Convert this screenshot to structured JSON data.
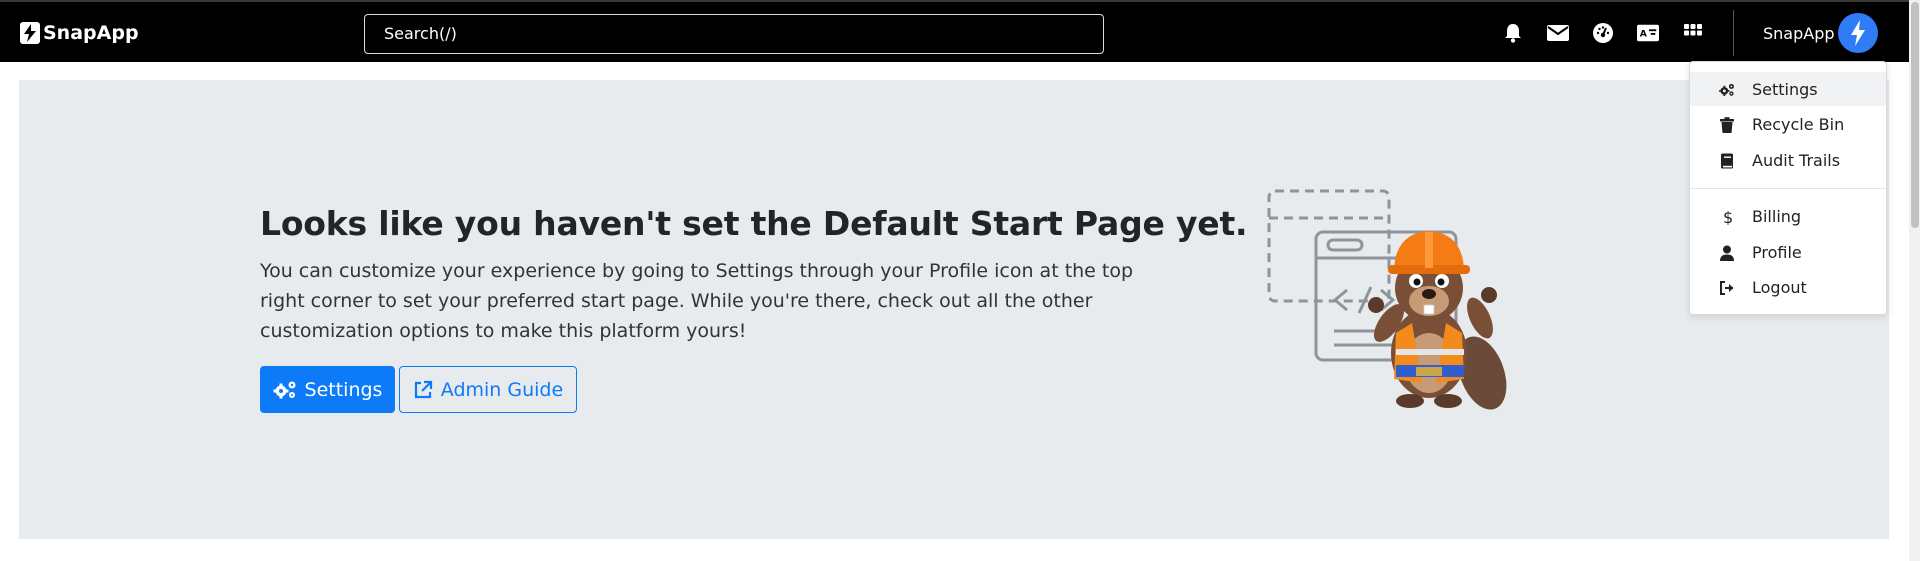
{
  "brand": {
    "name": "SnapApp"
  },
  "search": {
    "placeholder": "Search(/)"
  },
  "nav": {
    "icons": [
      "bell-icon",
      "envelope-icon",
      "dashboard-icon",
      "language-icon",
      "grid-icon"
    ],
    "user_name": "SnapApp"
  },
  "hero": {
    "title": "Looks like you haven't set the Default Start Page yet.",
    "text": "You can customize your experience by going to Settings through your Profile icon at the top right corner to set your preferred start page. While you're there, check out all the other customization options to make this platform yours!",
    "settings_button": "Settings",
    "admin_guide_button": "Admin Guide"
  },
  "dropdown": {
    "items": [
      {
        "label": "Settings",
        "icon": "gears-icon"
      },
      {
        "label": "Recycle Bin",
        "icon": "trash-icon"
      },
      {
        "label": "Audit Trails",
        "icon": "book-icon"
      },
      {
        "label": "Billing",
        "icon": "dollar-icon"
      },
      {
        "label": "Profile",
        "icon": "user-icon"
      },
      {
        "label": "Logout",
        "icon": "logout-icon"
      }
    ]
  },
  "colors": {
    "primary": "#0d7bf7",
    "avatar": "#2f7cf6",
    "hero_bg": "#e8ebee",
    "nav_bg": "#000000"
  }
}
